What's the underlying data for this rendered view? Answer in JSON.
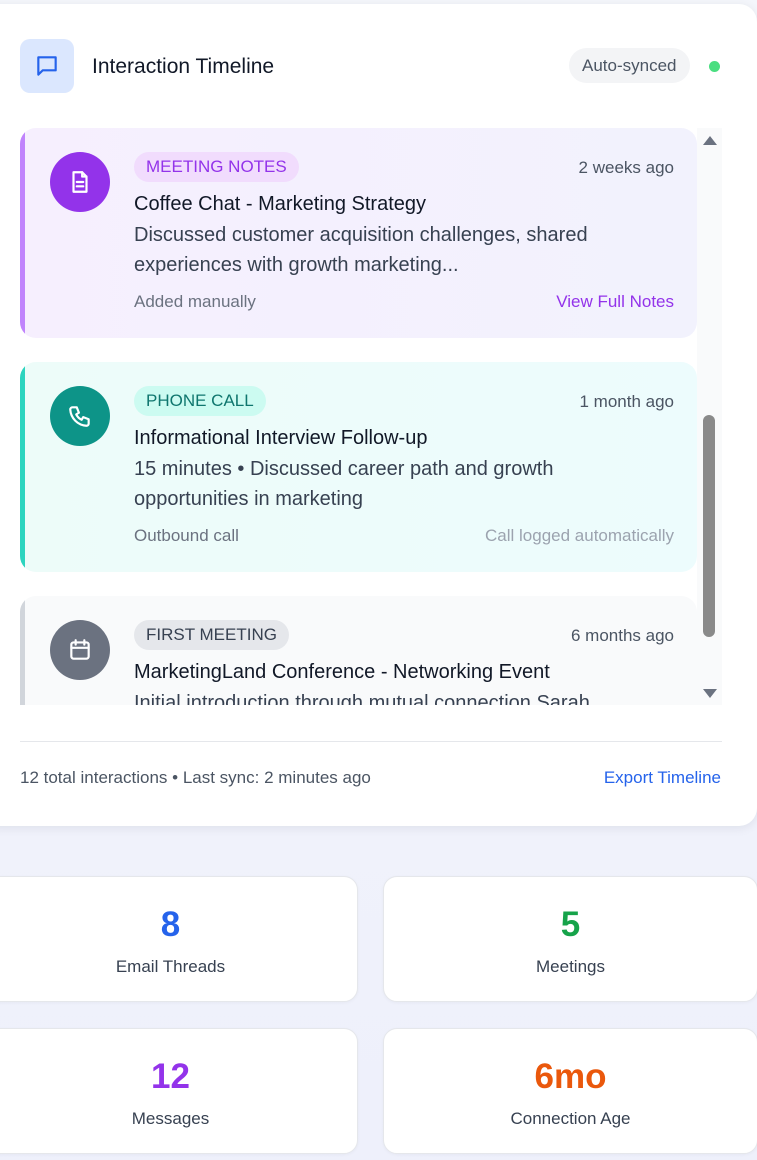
{
  "header": {
    "title": "Interaction Timeline",
    "sync_badge": "Auto-synced",
    "icon": "message-square-icon"
  },
  "timeline": [
    {
      "tag": "MEETING NOTES",
      "time": "2 weeks ago",
      "title": "Coffee Chat - Marketing Strategy",
      "description": "Discussed customer acquisition challenges, shared experiences with growth marketing...",
      "meta_left": "Added manually",
      "meta_right": "View Full Notes",
      "icon": "file-text-icon",
      "accent": "#9333ea"
    },
    {
      "tag": "PHONE CALL",
      "time": "1 month ago",
      "title": "Informational Interview Follow-up",
      "description": "15 minutes • Discussed career path and growth opportunities in marketing",
      "meta_left": "Outbound call",
      "meta_right": "Call logged automatically",
      "icon": "phone-icon",
      "accent": "#0d9488"
    },
    {
      "tag": "FIRST MEETING",
      "time": "6 months ago",
      "title": "MarketingLand Conference - Networking Event",
      "description": "Initial introduction through mutual connection Sarah",
      "icon": "calendar-icon",
      "accent": "#6b7280"
    }
  ],
  "footer": {
    "summary": "12 total interactions • Last sync: 2 minutes ago",
    "export_label": "Export Timeline"
  },
  "stats": [
    {
      "value": "8",
      "label": "Email Threads",
      "color": "#2563eb"
    },
    {
      "value": "5",
      "label": "Meetings",
      "color": "#16a34a"
    },
    {
      "value": "12",
      "label": "Messages",
      "color": "#9333ea"
    },
    {
      "value": "6mo",
      "label": "Connection Age",
      "color": "#ea580c"
    }
  ]
}
